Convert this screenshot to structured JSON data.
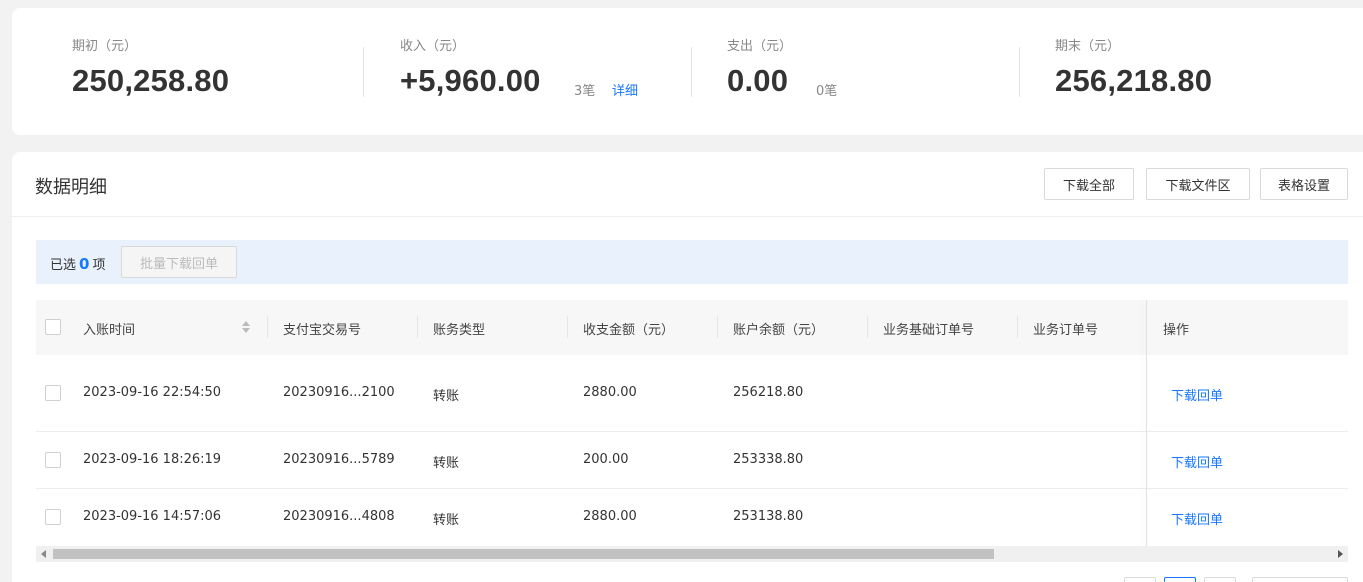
{
  "summary": {
    "opening": {
      "label": "期初（元）",
      "value": "250,258.80"
    },
    "income": {
      "label": "收入（元）",
      "value": "+5,960.00",
      "count": "3笔",
      "detail": "详细"
    },
    "expense": {
      "label": "支出（元）",
      "value": "0.00",
      "count": "0笔"
    },
    "closing": {
      "label": "期末（元）",
      "value": "256,218.80"
    }
  },
  "panel": {
    "title": "数据明细",
    "buttons": [
      "下载全部",
      "下载文件区",
      "表格设置"
    ]
  },
  "selection": {
    "prefix": "已选",
    "count": "0",
    "suffix": "项",
    "batch_button": "批量下载回单"
  },
  "table": {
    "columns": [
      "入账时间",
      "支付宝交易号",
      "账务类型",
      "收支金额（元）",
      "账户余额（元）",
      "业务基础订单号",
      "业务订单号",
      "操作"
    ],
    "rows": [
      {
        "time": "2023-09-16 22:54:50",
        "trade_no": "20230916...2100",
        "type": "转账",
        "amount": "2880.00",
        "balance": "256218.80",
        "base_order": "",
        "order": "",
        "action": "下载回单"
      },
      {
        "time": "2023-09-16 18:26:19",
        "trade_no": "20230916...5789",
        "type": "转账",
        "amount": "200.00",
        "balance": "253338.80",
        "base_order": "",
        "order": "",
        "action": "下载回单"
      },
      {
        "time": "2023-09-16 14:57:06",
        "trade_no": "20230916...4808",
        "type": "转账",
        "amount": "2880.00",
        "balance": "253138.80",
        "base_order": "",
        "order": "",
        "action": "下载回单"
      }
    ]
  },
  "colors": {
    "accent": "#1677ff",
    "selection_bg": "#e9f1fd"
  },
  "icons": {
    "sort": "sort-icon",
    "scroll_left": "scroll-left-arrow-icon",
    "scroll_right": "scroll-right-arrow-icon"
  }
}
